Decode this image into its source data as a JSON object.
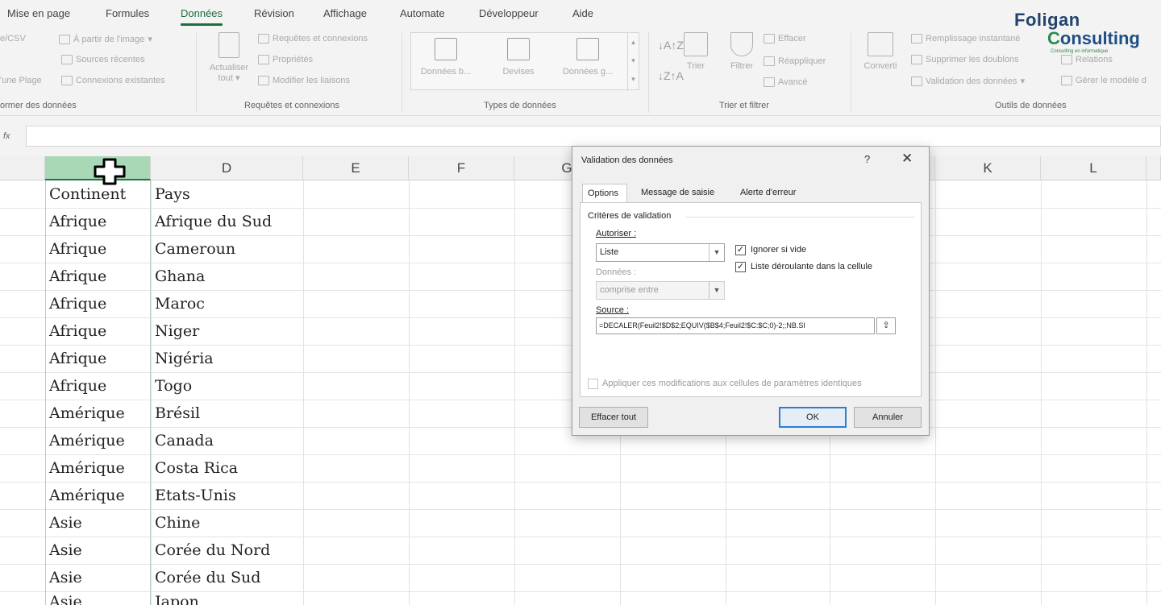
{
  "ribbon_tabs": [
    "Mise en page",
    "Formules",
    "Données",
    "Révision",
    "Affichage",
    "Automate",
    "Développeur",
    "Aide"
  ],
  "ribbon": {
    "transform": {
      "csv": "e/CSV",
      "plage": "'une Plage",
      "title": "ormer des données"
    },
    "get_data": {
      "image": "À partir de l'image",
      "recent": "Sources récentes",
      "existing": "Connexions existantes"
    },
    "refresh": {
      "label": "Actualiser",
      "sublabel": "tout"
    },
    "queries": {
      "connections": "Requêtes et connexions",
      "properties": "Propriétés",
      "edit_links": "Modifier les liaisons",
      "title": "Requêtes et connexions"
    },
    "data_types": {
      "items": [
        "Données b...",
        "Devises",
        "Données g..."
      ],
      "title": "Types de données"
    },
    "sort_filter": {
      "sort": "Trier",
      "filter": "Filtrer",
      "clear": "Effacer",
      "reapply": "Réappliquer",
      "advanced": "Avancé",
      "title": "Trier et filtrer"
    },
    "data_tools": {
      "convert": "Converti",
      "flash_fill": "Remplissage instantané",
      "remove_duplicates": "Supprimer les doublons",
      "validation": "Validation des données",
      "relations": "Relations",
      "manage_model": "Gérer le modèle d",
      "title": "Outils de données"
    }
  },
  "logo": {
    "line1": "Foligan",
    "line2_c": "C",
    "line2_rest": "onsulting",
    "tagline": "Consulting en informatique"
  },
  "formula_bar": {
    "fx": "fx",
    "value": ""
  },
  "columns": [
    "",
    "D",
    "E",
    "F",
    "G",
    "",
    "",
    "K",
    "L"
  ],
  "sheet": {
    "header": {
      "col_c": "Continent",
      "col_d": "Pays"
    },
    "rows": [
      {
        "c": "Afrique",
        "d": "Afrique du Sud"
      },
      {
        "c": "Afrique",
        "d": "Cameroun"
      },
      {
        "c": "Afrique",
        "d": "Ghana"
      },
      {
        "c": "Afrique",
        "d": "Maroc"
      },
      {
        "c": "Afrique",
        "d": "Niger"
      },
      {
        "c": "Afrique",
        "d": "Nigéria"
      },
      {
        "c": "Afrique",
        "d": "Togo"
      },
      {
        "c": "Amérique",
        "d": "Brésil"
      },
      {
        "c": "Amérique",
        "d": "Canada"
      },
      {
        "c": "Amérique",
        "d": "Costa Rica"
      },
      {
        "c": "Amérique",
        "d": "Etats-Unis"
      },
      {
        "c": "Asie",
        "d": "Chine"
      },
      {
        "c": "Asie",
        "d": "Corée du Nord"
      },
      {
        "c": "Asie",
        "d": "Corée du Sud"
      },
      {
        "c": "Asie",
        "d": "Japon"
      }
    ]
  },
  "dialog": {
    "title": "Validation des données",
    "help": "?",
    "close": "✕",
    "tabs": [
      "Options",
      "Message de saisie",
      "Alerte d'erreur"
    ],
    "criteria_label": "Critères de validation",
    "allow_label": "Autoriser :",
    "allow_value": "Liste",
    "ignore_blank": "Ignorer si vide",
    "dropdown_in_cell": "Liste déroulante dans la cellule",
    "data_label": "Données :",
    "data_value": "comprise entre",
    "source_label": "Source :",
    "source_value": "=DECALER(Feuil2!$D$2;EQUIV($B$4;Feuil2!$C:$C;0)-2;;NB.SI",
    "apply_all": "Appliquer ces modifications aux cellules de paramètres identiques",
    "clear_all": "Effacer tout",
    "ok": "OK",
    "cancel": "Annuler"
  }
}
